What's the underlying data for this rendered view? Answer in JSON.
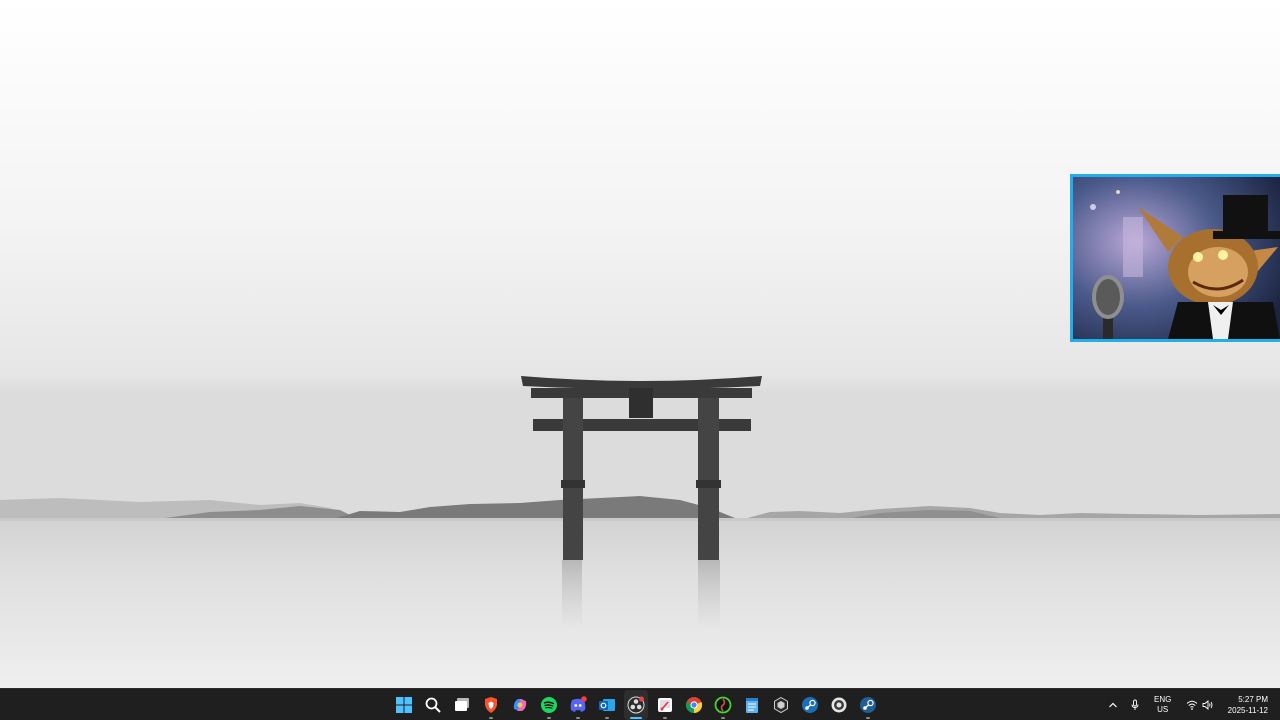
{
  "desktop": {
    "wallpaper": "torii-gate-lake-wallpaper",
    "pip_video": "gremlin-singer-video-thumbnail",
    "accent": "#22aee8"
  },
  "taskbar": {
    "background": "#1f1f1f",
    "apps": [
      {
        "icon": "windows-start-icon",
        "active": false,
        "running": false
      },
      {
        "icon": "search-icon",
        "active": false,
        "running": false
      },
      {
        "icon": "task-view-icon",
        "active": false,
        "running": false
      },
      {
        "icon": "brave-browser-icon",
        "active": false,
        "running": true
      },
      {
        "icon": "copilot-icon",
        "active": false,
        "running": false
      },
      {
        "icon": "spotify-icon",
        "active": false,
        "running": true
      },
      {
        "icon": "discord-icon",
        "active": false,
        "running": true
      },
      {
        "icon": "outlook-mail-icon",
        "active": false,
        "running": true
      },
      {
        "icon": "obs-studio-icon",
        "active": true,
        "running": true
      },
      {
        "icon": "snipping-tool-icon",
        "active": false,
        "running": true
      },
      {
        "icon": "chrome-icon",
        "active": false,
        "running": false
      },
      {
        "icon": "razer-synapse-icon",
        "active": false,
        "running": true
      },
      {
        "icon": "notepad-icon",
        "active": false,
        "running": false
      },
      {
        "icon": "unity-hub-icon",
        "active": false,
        "running": false
      },
      {
        "icon": "steam-icon",
        "active": false,
        "running": false
      },
      {
        "icon": "streamlabs-icon",
        "active": false,
        "running": false
      },
      {
        "icon": "steam-app-icon",
        "active": false,
        "running": true
      }
    ]
  },
  "tray": {
    "language_line1": "ENG",
    "language_line2": "US",
    "time": "5:27 PM",
    "date": "2025-11-12"
  }
}
